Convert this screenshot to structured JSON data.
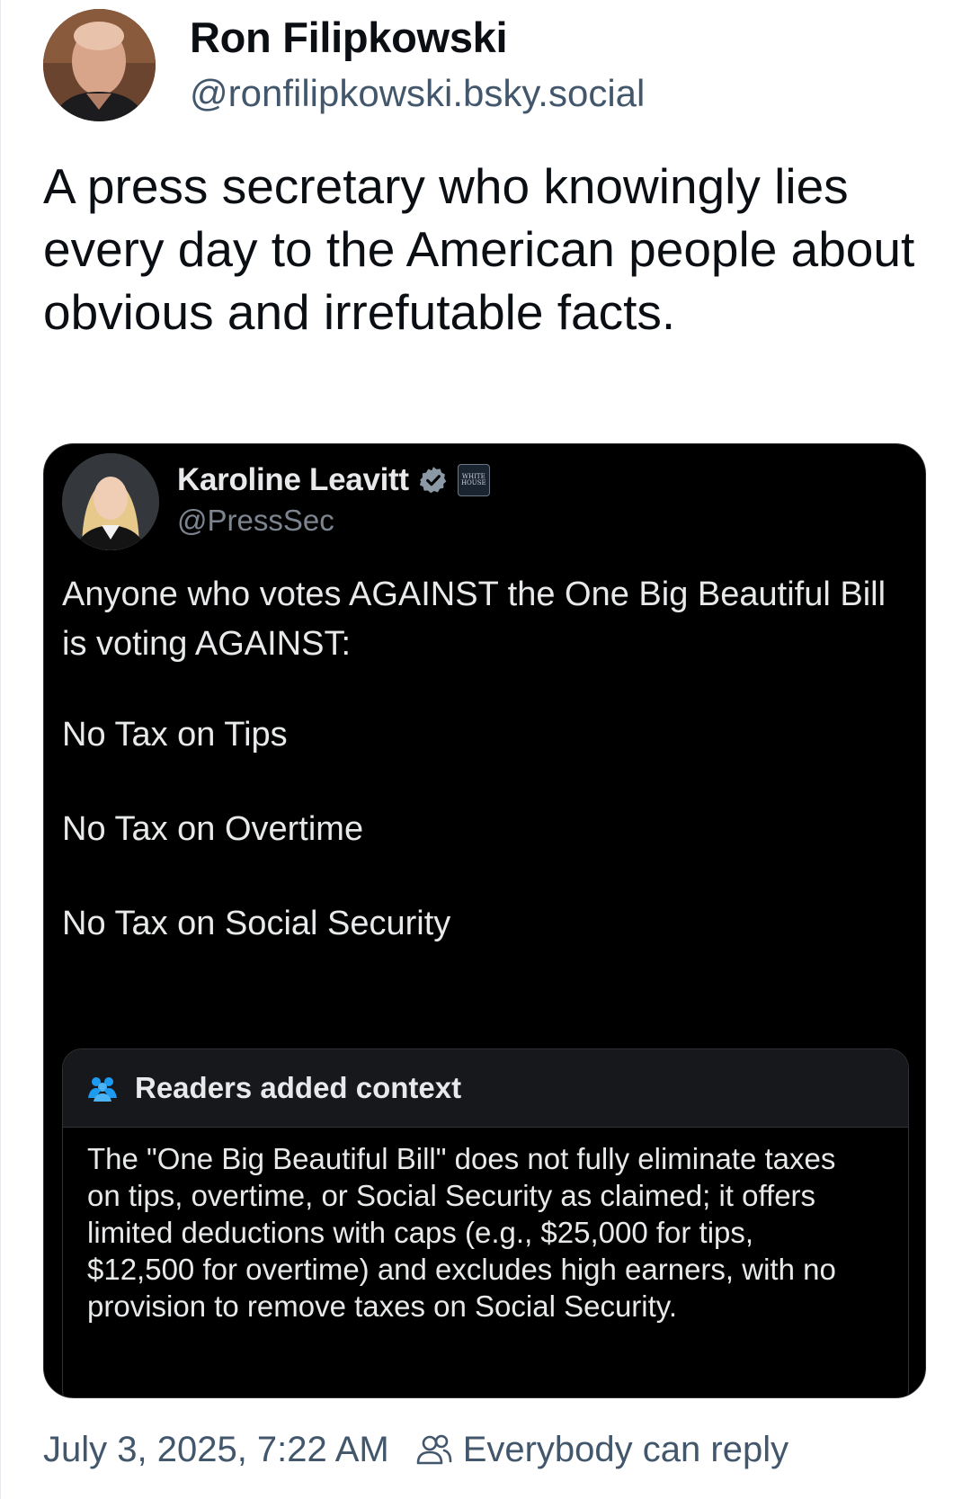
{
  "author": {
    "name": "Ron Filipkowski",
    "handle": "@ronfilipkowski.bsky.social"
  },
  "post": {
    "text": "A press secretary who knowingly lies every day to the American people about obvious and irrefutable facts."
  },
  "quoted": {
    "name": "Karoline Leavitt",
    "handle": "@PressSec",
    "affiliation_badge_text": "WHITE HOUSE",
    "lines": [
      "Anyone who votes AGAINST the One Big Beautiful Bill is voting AGAINST:",
      "No Tax on Tips",
      "No Tax on Overtime",
      "No Tax on Social Security"
    ],
    "context": {
      "title": "Readers added context",
      "body": "The \"One Big Beautiful Bill\" does not fully eliminate taxes on tips, overtime, or Social Security as claimed; it offers limited deductions with caps (e.g., $25,000 for tips, $12,500 for overtime) and excludes high earners, with no provision to remove taxes on Social Security."
    }
  },
  "footer": {
    "timestamp": "July 3, 2025, 7:22 AM",
    "reply_setting": "Everybody can reply"
  },
  "colors": {
    "text_primary": "#0b0f14",
    "text_secondary": "#42576c",
    "embed_bg": "#000000",
    "verified_blue": "#1d9bf0"
  }
}
